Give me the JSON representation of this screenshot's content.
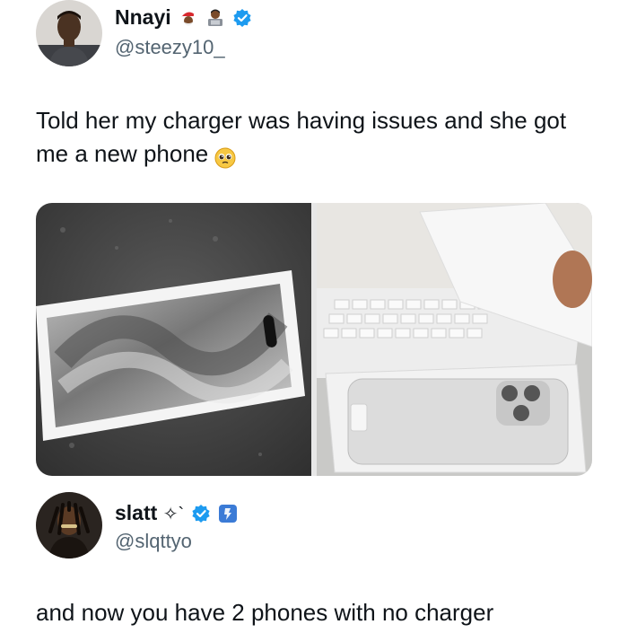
{
  "post1": {
    "display_name": "Nnayi",
    "handle": "@steezy10_",
    "badges": [
      "santa-emoji",
      "technologist-emoji",
      "verified-badge"
    ],
    "text": "Told her my charger was having issues and she got me a new phone",
    "text_emoji": "pleading-face-emoji",
    "media": [
      {
        "description_icon": "phone-box-photo"
      },
      {
        "description_icon": "white-phone-unboxing-photo"
      }
    ]
  },
  "post2": {
    "display_name": "slatt",
    "name_symbols": "✧`",
    "handle": "@slqttyo",
    "badges": [
      "verified-badge",
      "blue-square-emoji"
    ],
    "text": "and now you have 2 phones with no charger"
  },
  "colors": {
    "verified": "#1d9bf0",
    "text": "#0f1419",
    "muted": "#536471"
  }
}
